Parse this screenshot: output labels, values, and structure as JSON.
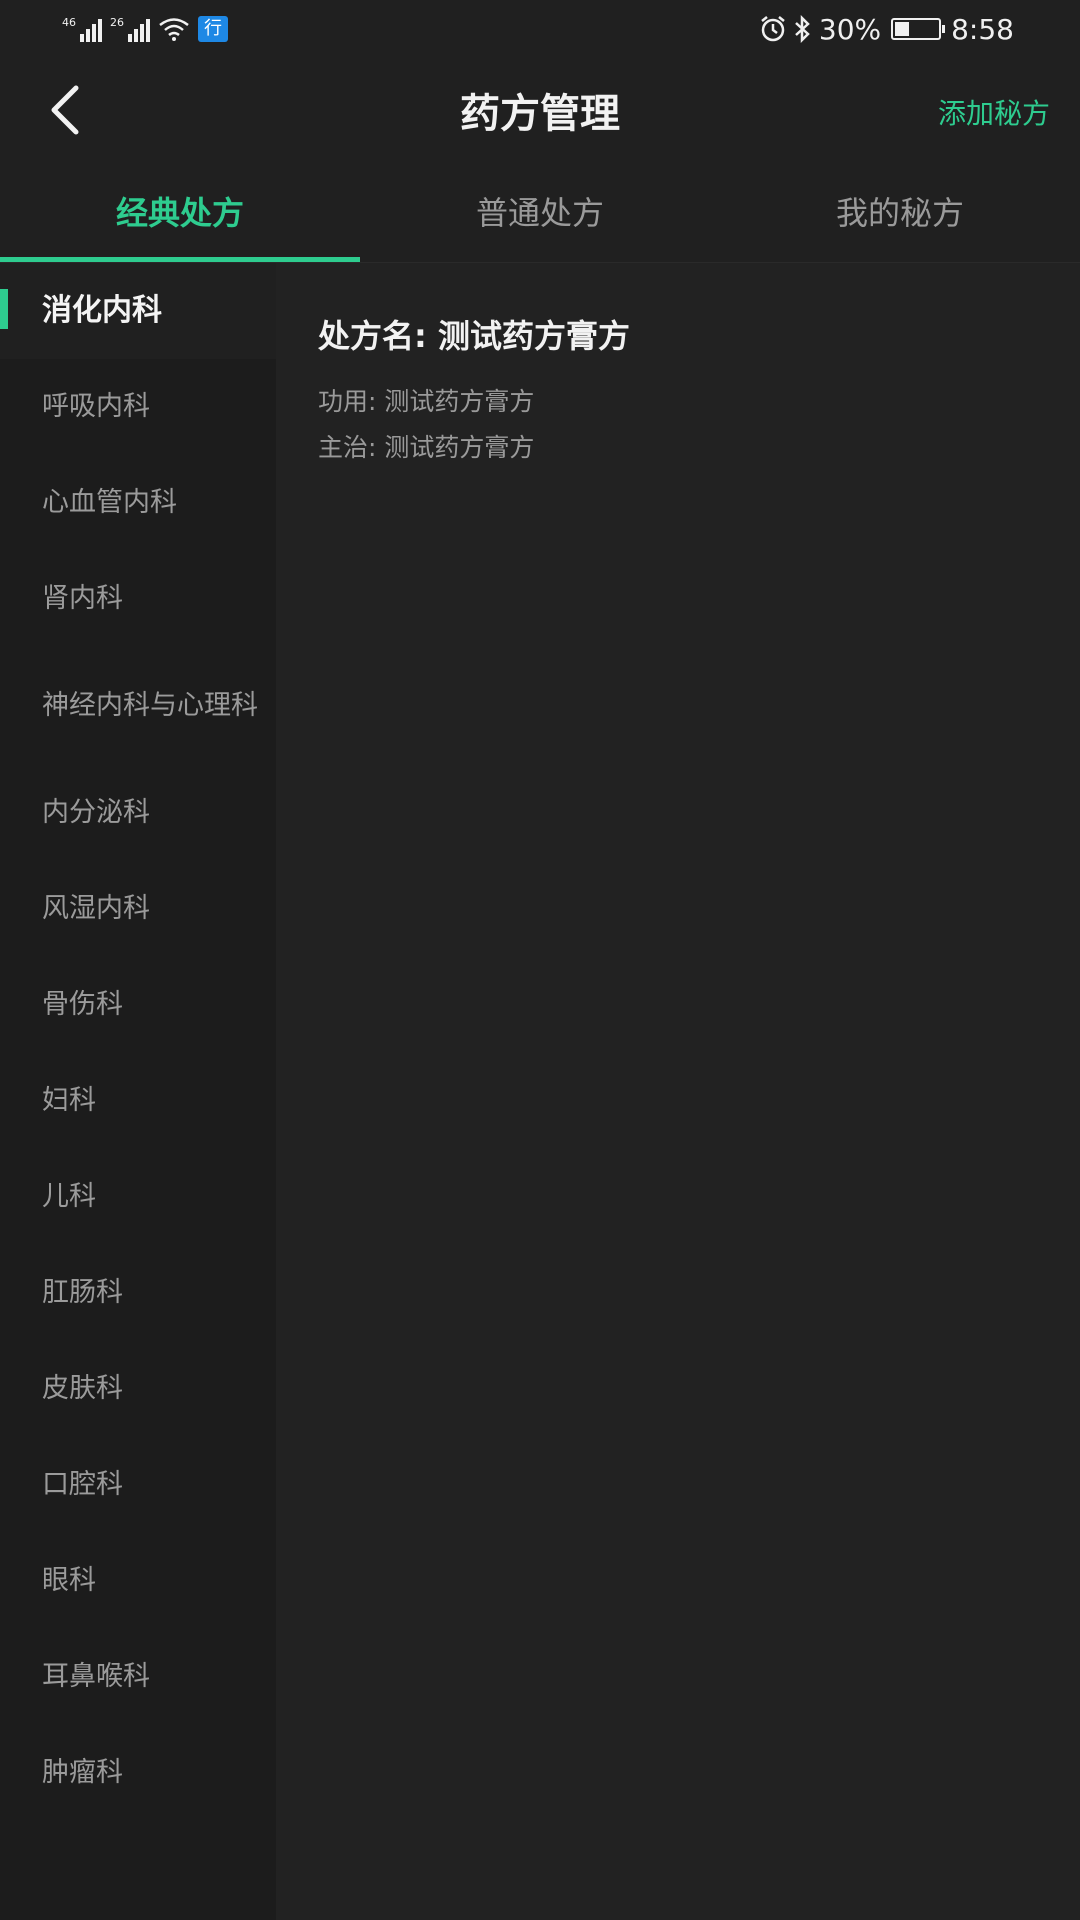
{
  "status_bar": {
    "signal1_label": "46",
    "signal2_label": "26",
    "service_badge": "行",
    "battery_percent": "30%",
    "time": "8:58"
  },
  "header": {
    "title": "药方管理",
    "add_label": "添加秘方"
  },
  "tabs": [
    {
      "label": "经典处方"
    },
    {
      "label": "普通处方"
    },
    {
      "label": "我的秘方"
    }
  ],
  "sidebar": {
    "items": [
      {
        "label": "消化内科"
      },
      {
        "label": "呼吸内科"
      },
      {
        "label": "心血管内科"
      },
      {
        "label": "肾内科"
      },
      {
        "label": "神经内科与心理科"
      },
      {
        "label": "内分泌科"
      },
      {
        "label": "风湿内科"
      },
      {
        "label": "骨伤科"
      },
      {
        "label": "妇科"
      },
      {
        "label": "儿科"
      },
      {
        "label": "肛肠科"
      },
      {
        "label": "皮肤科"
      },
      {
        "label": "口腔科"
      },
      {
        "label": "眼科"
      },
      {
        "label": "耳鼻喉科"
      },
      {
        "label": "肿瘤科"
      }
    ]
  },
  "prescription": {
    "name": "处方名: 测试药方膏方",
    "function": "功用: 测试药方膏方",
    "indication": "主治: 测试药方膏方"
  },
  "colors": {
    "accent": "#2ecc8f",
    "background": "#202020",
    "sidebar": "#1c1c1c"
  }
}
